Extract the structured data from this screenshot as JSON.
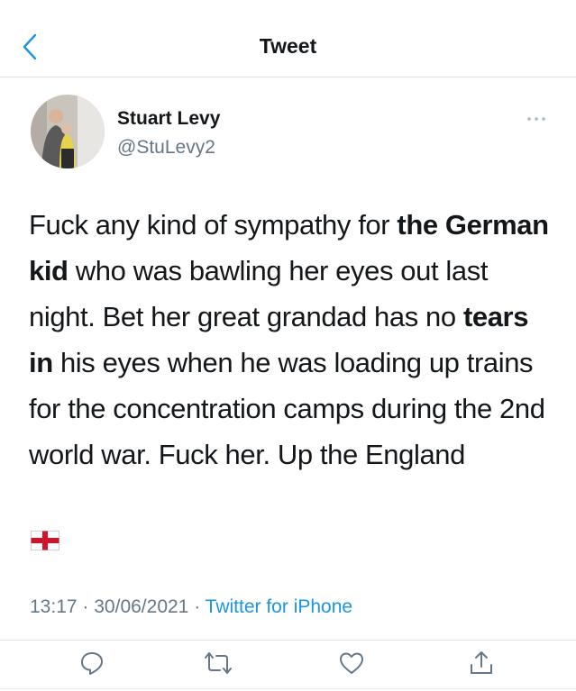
{
  "header": {
    "title": "Tweet"
  },
  "author": {
    "display_name": "Stuart Levy",
    "handle": "@StuLevy2"
  },
  "tweet": {
    "segments": [
      {
        "text": "Fuck any kind of sympathy for ",
        "bold": false
      },
      {
        "text": "the German kid",
        "bold": true
      },
      {
        "text": " who was bawling her eyes out last night. Bet her great grandad has no ",
        "bold": false
      },
      {
        "text": "tears in",
        "bold": true
      },
      {
        "text": " his eyes when he was loading up trains for the concentration camps during the 2nd world war. Fuck her. Up the England",
        "bold": false
      }
    ],
    "emoji": "england-flag"
  },
  "meta": {
    "time": "13:17",
    "separator": "·",
    "date": "30/06/2021",
    "source": "Twitter for iPhone"
  },
  "actions": [
    {
      "name": "reply-icon"
    },
    {
      "name": "retweet-icon"
    },
    {
      "name": "like-icon"
    },
    {
      "name": "share-icon"
    }
  ],
  "colors": {
    "accent": "#1b95e0",
    "text": "#14171a",
    "secondary": "#657786",
    "divider": "#dde2e6",
    "flag_red": "#cf142b"
  }
}
